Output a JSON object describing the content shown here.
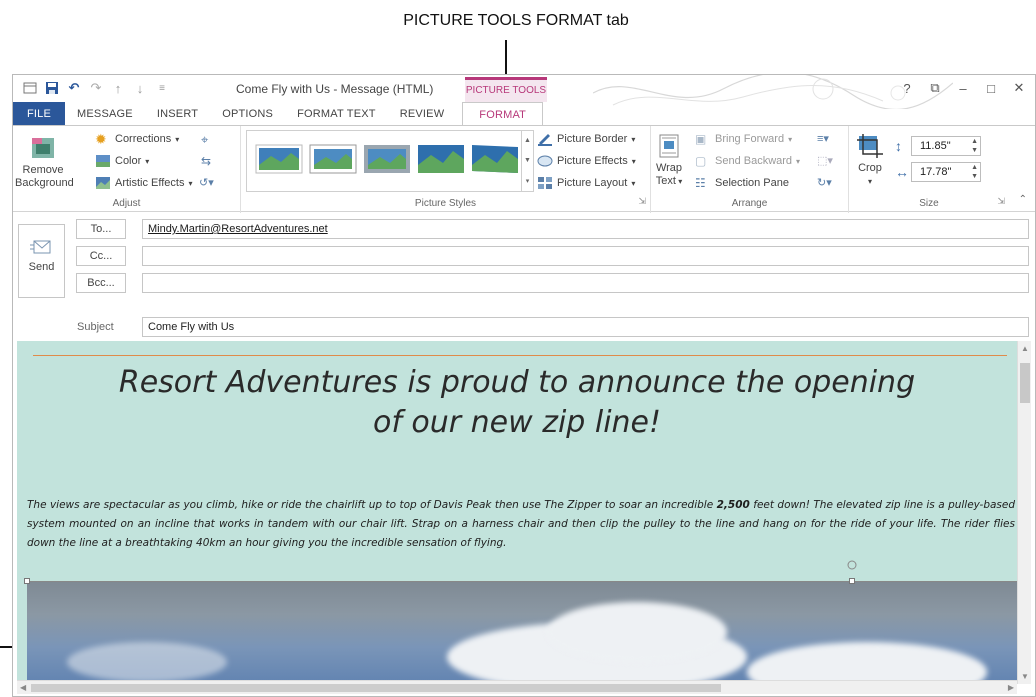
{
  "annotation": {
    "callout": "PICTURE TOOLS FORMAT tab"
  },
  "window": {
    "title": "Come Fly with Us - Message (HTML)",
    "context_label": "PICTURE TOOLS",
    "controls": {
      "help": "?",
      "restore": "⧉",
      "minimize": "–",
      "maximize": "□",
      "close": "✕"
    }
  },
  "tabs": [
    "FILE",
    "MESSAGE",
    "INSERT",
    "OPTIONS",
    "FORMAT TEXT",
    "REVIEW",
    "FORMAT"
  ],
  "ribbon": {
    "adjust": {
      "remove_bg": "Remove Background",
      "corrections": "Corrections",
      "color": "Color",
      "artistic": "Artistic Effects",
      "label": "Adjust"
    },
    "styles": {
      "border": "Picture Border",
      "effects": "Picture Effects",
      "layout": "Picture Layout",
      "label": "Picture Styles"
    },
    "arrange": {
      "wrap": "Wrap Text",
      "bring": "Bring Forward",
      "send": "Send Backward",
      "pane": "Selection Pane",
      "label": "Arrange"
    },
    "size": {
      "crop": "Crop",
      "height": "11.85\"",
      "width": "17.78\"",
      "label": "Size"
    }
  },
  "header": {
    "send": "Send",
    "to_btn": "To...",
    "cc_btn": "Cc...",
    "bcc_btn": "Bcc...",
    "to_value": "Mindy.Martin@ResortAdventures.net",
    "subject_label": "Subject",
    "subject_value": "Come Fly with Us"
  },
  "body": {
    "headline1": "Resort Adventures is proud to announce the opening",
    "headline2": "of our new zip line!",
    "para_a": "The views are spectacular as you climb, hike or ride the chairlift up to top of Davis Peak then use The Zipper to soar an incredible ",
    "para_bold": "2,500",
    "para_b": " feet down! The elevated zip line is a pulley-based system mounted on an incline that works in tandem with our chair lift.  Strap on a harness chair and then clip the pulley to the line and hang on for the ride of your life. The rider flies down the line at a breathtaking 40km an hour giving you the incredible sensation of flying."
  },
  "colors": {
    "accent": "#b7387a",
    "file_tab": "#2b579a",
    "body_bg": "#c2e3dc",
    "rule": "#e08b4a"
  }
}
